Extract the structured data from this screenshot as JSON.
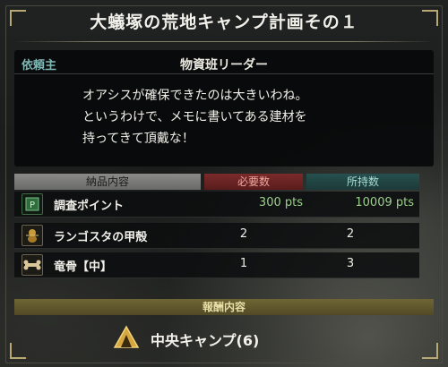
{
  "quest": {
    "title": "大蟻塚の荒地キャンプ計画その１",
    "client_label": "依頼主",
    "client_name": "物資班リーダー",
    "message_lines": [
      "オアシスが確保できたのは大きいわね。",
      "というわけで、メモに書いてある建材を",
      "持ってきて頂戴な！"
    ]
  },
  "table": {
    "headers": {
      "items": "納品内容",
      "required": "必要数",
      "owned": "所持数"
    },
    "rows": [
      {
        "name": "調査ポイント",
        "required": "300 pts",
        "owned": "10009 pts",
        "icon": "research-points-icon"
      },
      {
        "name": "ランゴスタの甲殻",
        "required": "2",
        "owned": "2",
        "icon": "vespoid-shell-icon"
      },
      {
        "name": "竜骨【中】",
        "required": "1",
        "owned": "3",
        "icon": "monster-bone-icon"
      }
    ]
  },
  "reward": {
    "header": "報酬内容",
    "label": "中央キャンプ(6)",
    "icon": "camp-tent-icon"
  },
  "colors": {
    "accent_gold": "#b8a874",
    "client_teal": "#7fb7b4",
    "points_green": "#9cd08c",
    "required_red": "#7a2a2a",
    "owned_teal": "#26504e"
  }
}
